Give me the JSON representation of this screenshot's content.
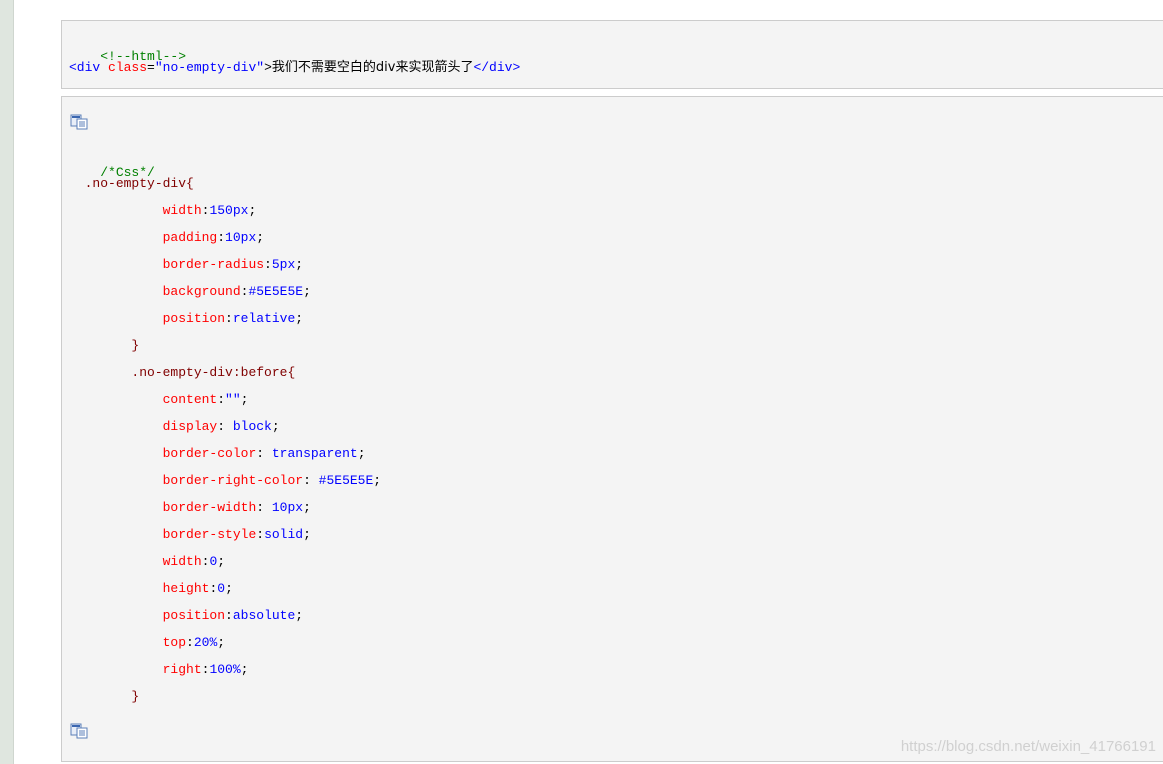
{
  "html_block": {
    "comment": "<!--html-->",
    "tag_open": "<div",
    "attr_name": "class",
    "attr_eq": "=",
    "attr_value": "\"no-empty-div\"",
    "tag_close": ">",
    "text": "我们不需要空白的div来实现箭头了",
    "tag_end": "</div>"
  },
  "css_block": {
    "comment": "/*Css*/",
    "lines": [
      {
        "indent": "  ",
        "selector": ".no-empty-div{"
      },
      {
        "indent": "            ",
        "prop": "width",
        "val": "150px"
      },
      {
        "indent": "            ",
        "prop": "padding",
        "val": "10px"
      },
      {
        "indent": "            ",
        "prop": "border-radius",
        "val": "5px"
      },
      {
        "indent": "            ",
        "prop": "background",
        "val": "#5E5E5E"
      },
      {
        "indent": "            ",
        "prop": "position",
        "val": "relative"
      },
      {
        "indent": "        ",
        "selector": "}"
      },
      {
        "indent": "        ",
        "selector": ".no-empty-div:before{"
      },
      {
        "indent": "            ",
        "prop": "content",
        "val": "\"\""
      },
      {
        "indent": "            ",
        "prop": "display",
        "val": " block"
      },
      {
        "indent": "            ",
        "prop": "border-color",
        "val": " transparent"
      },
      {
        "indent": "            ",
        "prop": "border-right-color",
        "val": " #5E5E5E"
      },
      {
        "indent": "            ",
        "prop": "border-width",
        "val": " 10px"
      },
      {
        "indent": "            ",
        "prop": "border-style",
        "val": "solid"
      },
      {
        "indent": "            ",
        "prop": "width",
        "val": "0"
      },
      {
        "indent": "            ",
        "prop": "height",
        "val": "0"
      },
      {
        "indent": "            ",
        "prop": "position",
        "val": "absolute"
      },
      {
        "indent": "            ",
        "prop": "top",
        "val": "20%"
      },
      {
        "indent": "            ",
        "prop": "right",
        "val": "100%"
      },
      {
        "indent": "        ",
        "selector": "}"
      }
    ]
  },
  "copy_icon": "copy-icon",
  "watermark": "https://blog.csdn.net/weixin_41766191",
  "colors": {
    "comment": "#008000",
    "tag": "#0000ff",
    "attr": "#ff0000",
    "selector": "#800000",
    "property": "#ff0000",
    "value": "#0000ff",
    "background": "#f4f4f4"
  }
}
